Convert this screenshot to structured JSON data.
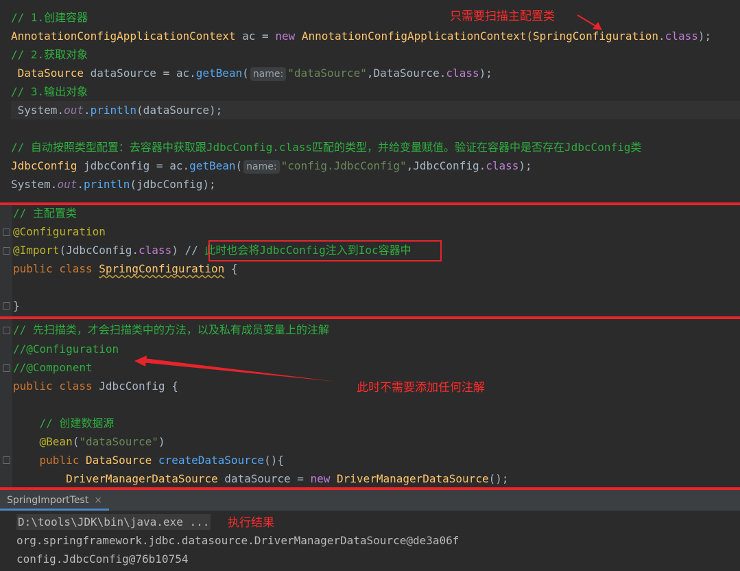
{
  "code_top": {
    "l1": "// 1.创建容器",
    "l2_cls": "AnnotationConfigApplicationContext",
    "l2_var": " ac = ",
    "l2_new": "new",
    "l2_cls2": " AnnotationConfigApplicationContext(",
    "l2_arg": "SpringConfiguration",
    "l2_dot": ".",
    "l2_kw": "class",
    "l2_end": ");",
    "l3": "// 2.获取对象",
    "l4_cls": " DataSource",
    "l4_var": " dataSource = ac.",
    "l4_m": "getBean",
    "l4_p": "(",
    "l4_hint": "name:",
    "l4_str": "\"dataSource\"",
    "l4_rest1": ",DataSource.",
    "l4_kw": "class",
    "l4_rest2": ");",
    "l5": "// 3.输出对象",
    "l6_a": " System.",
    "l6_f": "out",
    "l6_b": ".",
    "l6_m": "println",
    "l6_c": "(dataSource);",
    "l7": "// 自动按照类型配置：去容器中获取跟JdbcConfig.class匹配的类型，并给变量赋值。验证在容器中是否存在JdbcConfig类",
    "l8_cls": "JdbcConfig",
    "l8_var": " jdbcConfig = ac.",
    "l8_m": "getBean",
    "l8_p": "(",
    "l8_hint": "name:",
    "l8_str": "\"config.JdbcConfig\"",
    "l8_rest1": ",JdbcConfig.",
    "l8_kw": "class",
    "l8_rest2": ");",
    "l9_a": "System.",
    "l9_f": "out",
    "l9_b": ".",
    "l9_m": "println",
    "l9_c": "(jdbcConfig);"
  },
  "code_mid": {
    "l1": "// 主配置类",
    "l2": "@Configuration",
    "l3_ann": "@Import",
    "l3_a": "(JdbcConfig.",
    "l3_kw": "class",
    "l3_b": ") //",
    "l3_cm": " 此时也会将JdbcConfig注入到Ioc容器中",
    "l4_kw": "public class",
    "l4_cls": "SpringConfiguration",
    "l4_end": " {",
    "l5": "}"
  },
  "code_bot": {
    "l1": "// 先扫描类，才会扫描类中的方法，以及私有成员变量上的注解",
    "l2": "//@Configuration",
    "l3": "//@Component",
    "l4_kw": "public class",
    "l4_cls": " JdbcConfig {",
    "l5": "    // 创建数据源",
    "l6_ann": "    @Bean",
    "l6_a": "(",
    "l6_str": "\"dataSource\"",
    "l6_b": ")",
    "l7_kw": "    public",
    "l7_cls": " DataSource",
    "l7_m": " createDataSource",
    "l7_b": "(){",
    "l8_cls": "        DriverManagerDataSource",
    "l8_var": " dataSource = ",
    "l8_new": "new",
    "l8_cls2": " DriverManagerDataSource",
    "l8_b": "();"
  },
  "annotations": {
    "top_note": "只需要扫描主配置类",
    "mid_note": "此时不需要添加任何注解",
    "run_note": "执行结果"
  },
  "run_panel": {
    "tab_label": "SpringImportTest",
    "tab_close": "×",
    "cmd": "D:\\tools\\JDK\\bin\\java.exe ...",
    "out1": "org.springframework.jdbc.datasource.DriverManagerDataSource@de3a06f",
    "out2": "config.JdbcConfig@76b10754"
  },
  "colors": {
    "background": "#2b2b2b",
    "comment": "#2fae3f",
    "keyword": "#cc7832",
    "annotation_red": "#e8242b"
  }
}
